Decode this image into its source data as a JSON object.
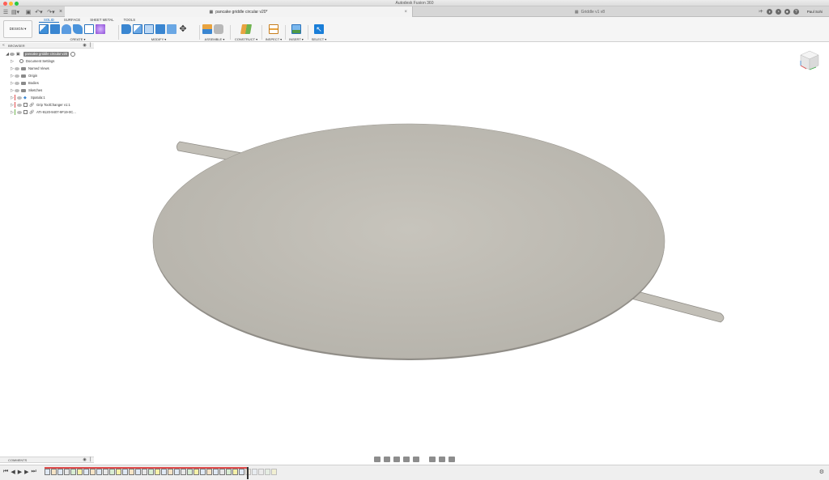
{
  "window": {
    "app_title": "Autodesk Fusion 360"
  },
  "tabs": [
    {
      "label": "pancake griddle circular v20*",
      "active": true
    },
    {
      "label": "Griddle v1 v8",
      "active": false
    }
  ],
  "user": {
    "name": "Paul Sohi"
  },
  "ribbon": {
    "workspace_button": "DESIGN ▾",
    "workspace_tabs": [
      {
        "label": "SOLID",
        "active": true
      },
      {
        "label": "SURFACE"
      },
      {
        "label": "SHEET METAL"
      },
      {
        "label": "TOOLS"
      }
    ],
    "groups": [
      {
        "label": "CREATE ▾"
      },
      {
        "label": "MODIFY ▾"
      },
      {
        "label": "ASSEMBLE ▾"
      },
      {
        "label": "CONSTRUCT ▾"
      },
      {
        "label": "INSPECT ▾"
      },
      {
        "label": "INSERT ▾"
      },
      {
        "label": "SELECT ▾"
      }
    ]
  },
  "browser": {
    "header": "BROWSER",
    "root": "pancake griddle circular v20",
    "items": [
      {
        "label": "Document Settings",
        "type": "settings"
      },
      {
        "label": "Named Views",
        "type": "folder"
      },
      {
        "label": "Origin",
        "type": "folder"
      },
      {
        "label": "Bodies",
        "type": "folder"
      },
      {
        "label": "Sketches",
        "type": "folder"
      },
      {
        "label": "Spatula:1",
        "type": "component"
      },
      {
        "label": "Grip ToolChanger v1:1",
        "type": "link"
      },
      {
        "label": "ATI-9120-9407-9F19-0C...",
        "type": "link"
      }
    ]
  },
  "comments": {
    "header": "COMMENTS"
  },
  "colors": {
    "accent": "#1a6fc2",
    "model_surface": "#bfbcb4",
    "timeline_marker": "#e04c4c"
  }
}
